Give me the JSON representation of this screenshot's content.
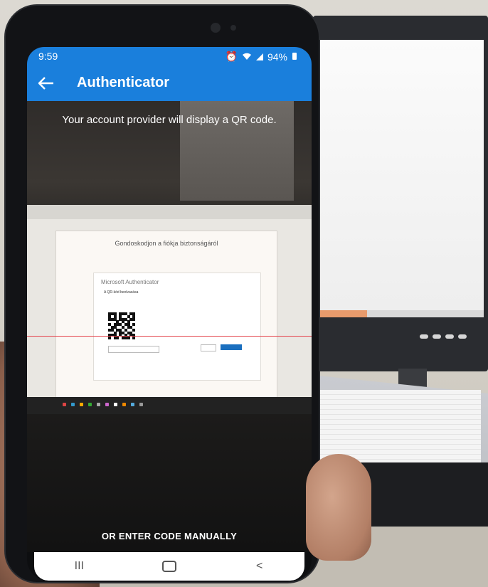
{
  "status": {
    "time": "9:59",
    "battery": "94%",
    "icons": [
      "alarm-icon",
      "wifi-icon",
      "signal-icon",
      "battery-icon"
    ]
  },
  "appbar": {
    "title": "Authenticator",
    "back_icon": "arrow-left-icon"
  },
  "scanner": {
    "prompt": "Your account provider will display a QR code.",
    "manual_entry_label": "OR ENTER CODE MANUALLY"
  },
  "laptop_screen": {
    "page_title": "Gondoskodjon a fiókja biztonságáról",
    "dialog_title": "Microsoft Authenticator",
    "dialog_heading": "A QR-kód beolvasása"
  },
  "navbar": {
    "recent_label": "III",
    "back_label": "<"
  },
  "colors": {
    "accent": "#1a7fdc",
    "scanline": "#e4434b"
  }
}
